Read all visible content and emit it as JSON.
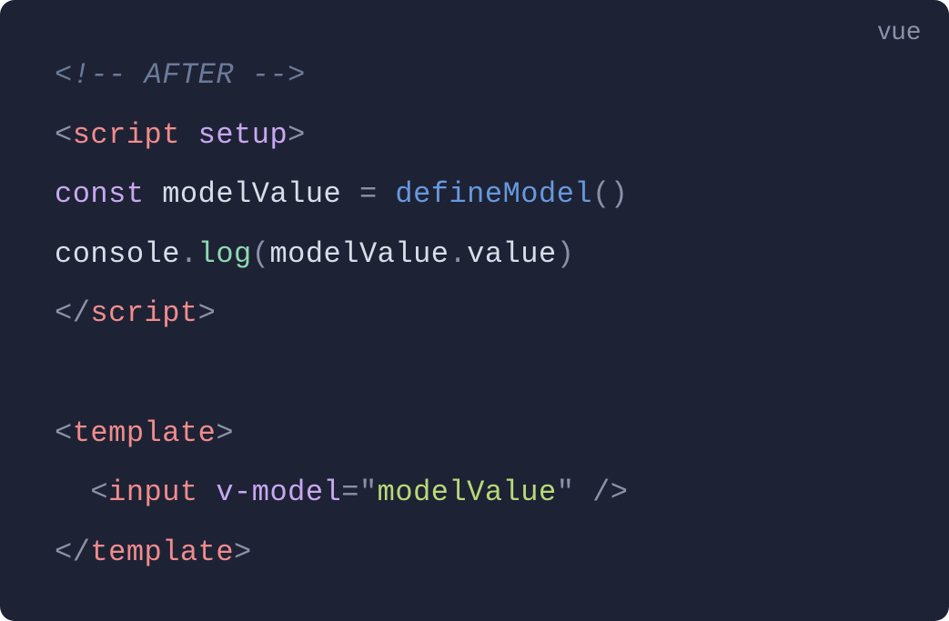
{
  "language": "vue",
  "code": {
    "line1": {
      "comment": "<!-- AFTER -->"
    },
    "line2": {
      "open": "<",
      "tag": "script",
      "space": " ",
      "attr": "setup",
      "close": ">"
    },
    "line3": {
      "keyword": "const",
      "space1": " ",
      "variable": "modelValue",
      "space2": " ",
      "equals": "=",
      "space3": " ",
      "func": "defineModel",
      "parens": "()"
    },
    "line4": {
      "obj": "console",
      "dot1": ".",
      "method": "log",
      "openParen": "(",
      "arg": "modelValue",
      "dot2": ".",
      "prop": "value",
      "closeParen": ")"
    },
    "line5": {
      "open": "</",
      "tag": "script",
      "close": ">"
    },
    "line6": {
      "open": "<",
      "tag": "template",
      "close": ">"
    },
    "line7": {
      "indent": "  ",
      "open": "<",
      "tag": "input",
      "space1": " ",
      "attr": "v-model",
      "equals": "=",
      "quote1": "\"",
      "value": "modelValue",
      "quote2": "\"",
      "space2": " ",
      "close": "/>"
    },
    "line8": {
      "open": "</",
      "tag": "template",
      "close": ">"
    }
  }
}
